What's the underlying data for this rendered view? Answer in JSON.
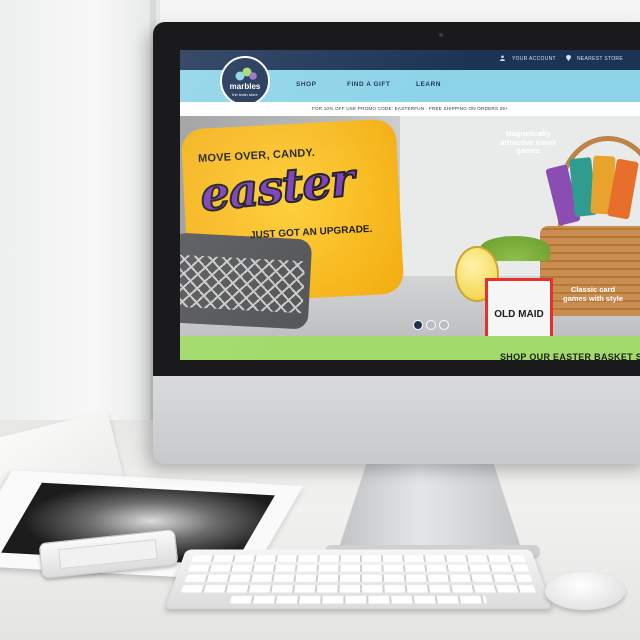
{
  "site": {
    "logo": {
      "name": "marbles",
      "tagline": "the brain store"
    },
    "utility_nav": {
      "account_label": "YOUR ACCOUNT",
      "store_label": "NEAREST STORE"
    },
    "main_nav": [
      {
        "label": "SHOP"
      },
      {
        "label": "FIND A GIFT"
      },
      {
        "label": "LEARN"
      }
    ],
    "promo_bar": "FOR 10% OFF USE PROMO CODE: EASTERFUN · FREE SHIPPING ON ORDERS 25+",
    "hero": {
      "line1": "MOVE OVER, CANDY.",
      "line2": "easter",
      "line3": "JUST GOT AN UPGRADE.",
      "callout_travel": "Magnetically attractive travel games",
      "callout_card": "Classic card games with style",
      "card_game": "OLD MAID",
      "carousel": {
        "slides": 3,
        "active": 1
      }
    },
    "banner": "SHOP OUR EASTER BASKET STUFFERS"
  },
  "colors": {
    "nav_dark": "#1c3355",
    "nav_light": "#8cd3e8",
    "headline_purple": "#7b3fb8",
    "pillow_yellow": "#f2ac10",
    "banner_green": "#a2db6c"
  },
  "icons": [
    "user-icon",
    "location-pin-icon"
  ]
}
